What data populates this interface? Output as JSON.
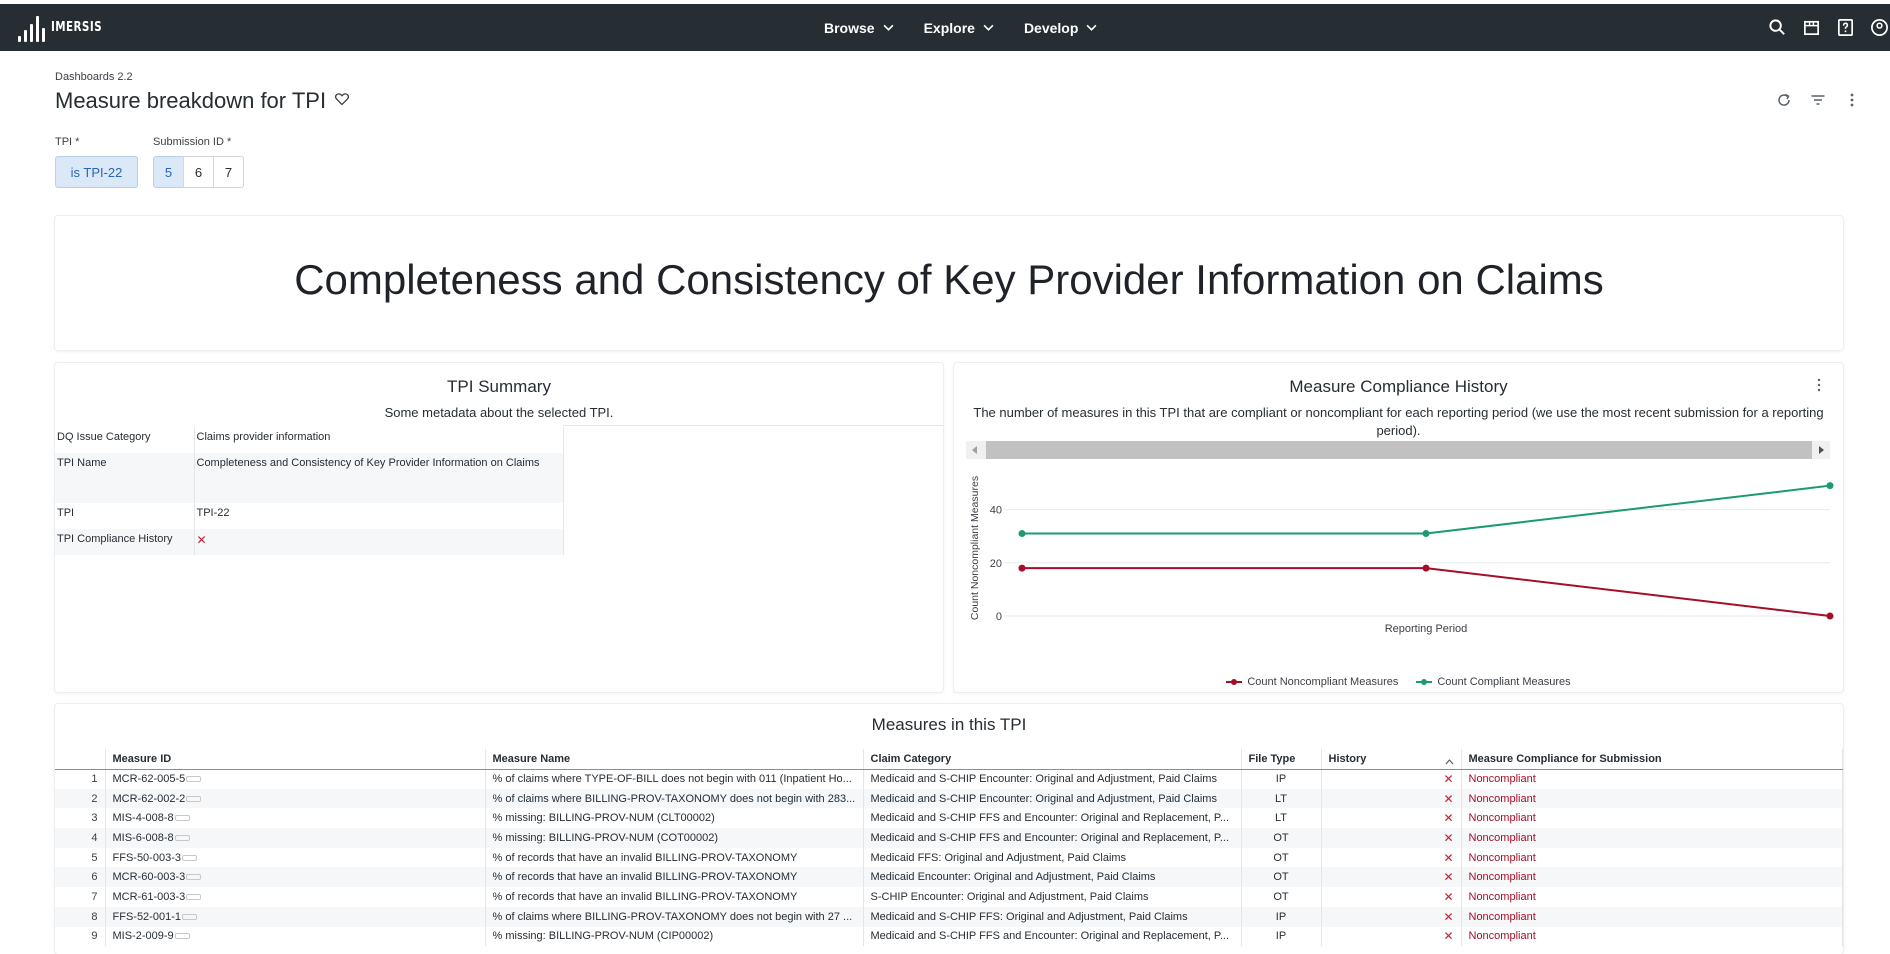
{
  "app": {
    "logo_text": "IMERSIS",
    "nav": [
      {
        "label": "Browse"
      },
      {
        "label": "Explore"
      },
      {
        "label": "Develop"
      }
    ]
  },
  "page": {
    "breadcrumb": "Dashboards 2.2",
    "title": "Measure breakdown for TPI"
  },
  "filters": {
    "tpi_label": "TPI *",
    "tpi_value": "is TPI-22",
    "submission_label": "Submission ID *",
    "submission_options": [
      "5",
      "6",
      "7"
    ],
    "submission_selected": "5"
  },
  "hero": {
    "title": "Completeness and Consistency of Key Provider Information on Claims"
  },
  "tpi_summary": {
    "title": "TPI Summary",
    "subtitle": "Some metadata about the selected TPI.",
    "rows": [
      {
        "key": "DQ Issue Category",
        "value": "Claims provider information"
      },
      {
        "key": "TPI Name",
        "value": "Completeness and Consistency of Key Provider Information on Claims"
      },
      {
        "key": "TPI",
        "value": "TPI-22"
      },
      {
        "key": "TPI Compliance History",
        "value": "✕"
      }
    ]
  },
  "history": {
    "title": "Measure Compliance History",
    "subtitle": "The number of measures in this TPI that are compliant or noncompliant for each reporting period (we use the most recent submission for a reporting period).",
    "legend": [
      "Count Noncompliant Measures",
      "Count Compliant Measures"
    ]
  },
  "chart_data": {
    "type": "line",
    "xlabel": "Reporting Period",
    "ylabel": "Count Noncompliant Measures",
    "ylim": [
      0,
      50
    ],
    "yticks": [
      0,
      20,
      40
    ],
    "x": [
      1,
      2,
      3
    ],
    "series": [
      {
        "name": "Count Noncompliant Measures",
        "color": "#a50e28",
        "values": [
          18,
          18,
          0
        ]
      },
      {
        "name": "Count Compliant Measures",
        "color": "#1a9c6c",
        "values": [
          31,
          31,
          49
        ]
      }
    ],
    "grid": true,
    "legend_position": "bottom"
  },
  "measures": {
    "title": "Measures in this TPI",
    "columns": [
      "Measure ID",
      "Measure Name",
      "Claim Category",
      "File Type",
      "History",
      "Measure Compliance for Submission"
    ],
    "rows": [
      {
        "n": "1",
        "id": "MCR-62-005-5",
        "name": "% of claims where TYPE-OF-BILL does not begin with 011 (Inpatient Ho...",
        "category": "Medicaid and S-CHIP Encounter: Original and Adjustment, Paid Claims",
        "file": "IP",
        "status": "Noncompliant"
      },
      {
        "n": "2",
        "id": "MCR-62-002-2",
        "name": "% of claims where BILLING-PROV-TAXONOMY does not begin with 283...",
        "category": "Medicaid and S-CHIP Encounter: Original and Adjustment, Paid Claims",
        "file": "LT",
        "status": "Noncompliant"
      },
      {
        "n": "3",
        "id": "MIS-4-008-8",
        "name": "% missing: BILLING-PROV-NUM (CLT00002)",
        "category": "Medicaid and S-CHIP FFS and Encounter: Original and Replacement, P...",
        "file": "LT",
        "status": "Noncompliant"
      },
      {
        "n": "4",
        "id": "MIS-6-008-8",
        "name": "% missing: BILLING-PROV-NUM (COT00002)",
        "category": "Medicaid and S-CHIP FFS and Encounter: Original and Replacement, P...",
        "file": "OT",
        "status": "Noncompliant"
      },
      {
        "n": "5",
        "id": "FFS-50-003-3",
        "name": "% of records that have an invalid BILLING-PROV-TAXONOMY",
        "category": "Medicaid FFS: Original and Adjustment, Paid Claims",
        "file": "OT",
        "status": "Noncompliant"
      },
      {
        "n": "6",
        "id": "MCR-60-003-3",
        "name": "% of records that have an invalid BILLING-PROV-TAXONOMY",
        "category": "Medicaid Encounter: Original and Adjustment, Paid Claims",
        "file": "OT",
        "status": "Noncompliant"
      },
      {
        "n": "7",
        "id": "MCR-61-003-3",
        "name": "% of records that have an invalid BILLING-PROV-TAXONOMY",
        "category": "S-CHIP Encounter: Original and Adjustment, Paid Claims",
        "file": "OT",
        "status": "Noncompliant"
      },
      {
        "n": "8",
        "id": "FFS-52-001-1",
        "name": "% of claims where BILLING-PROV-TAXONOMY does not begin with 27 ...",
        "category": "Medicaid and S-CHIP FFS: Original and Adjustment, Paid Claims",
        "file": "IP",
        "status": "Noncompliant"
      },
      {
        "n": "9",
        "id": "MIS-2-009-9",
        "name": "% missing: BILLING-PROV-NUM (CIP00002)",
        "category": "Medicaid and S-CHIP FFS and Encounter: Original and Replacement, P...",
        "file": "IP",
        "status": "Noncompliant"
      }
    ]
  }
}
